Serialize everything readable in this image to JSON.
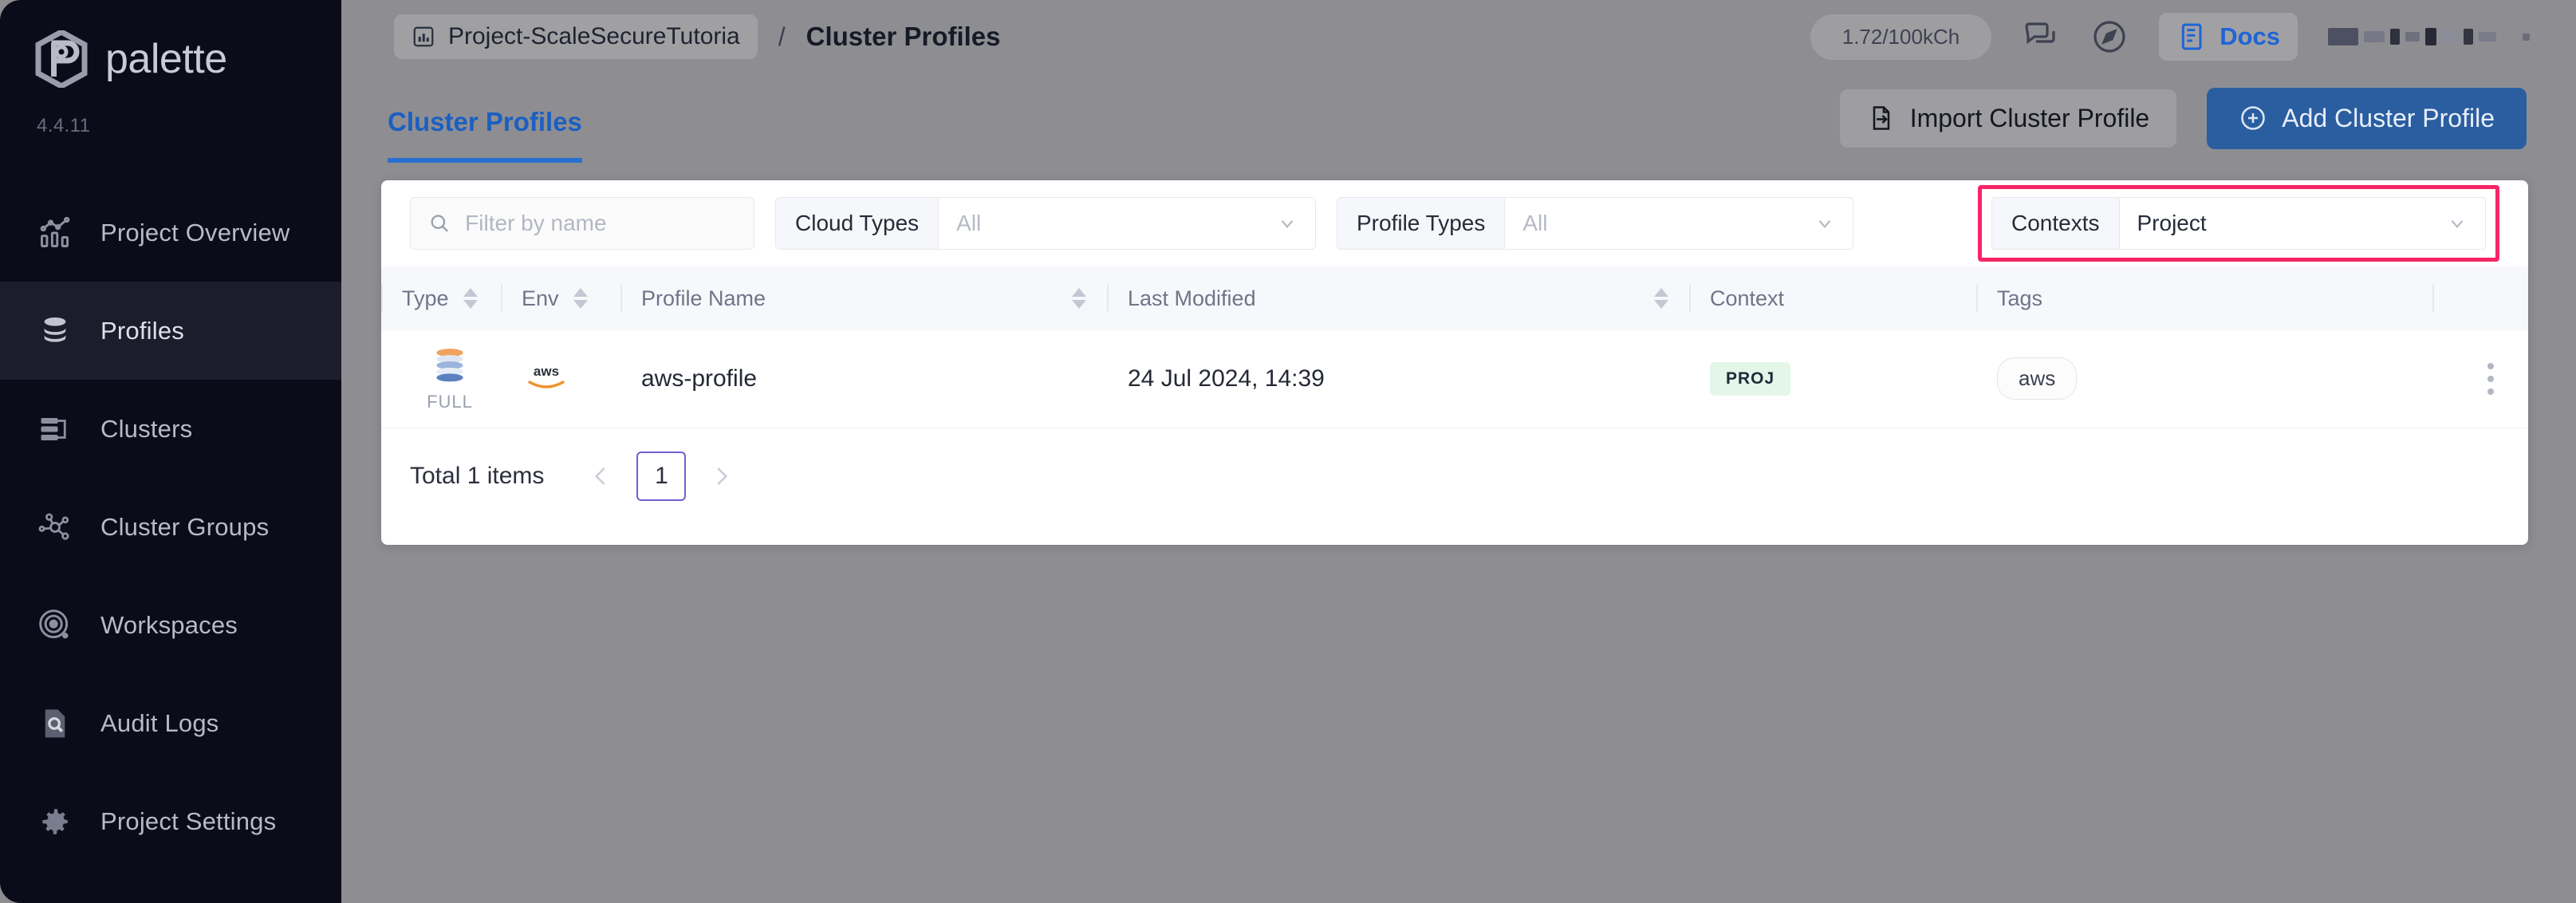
{
  "brand": {
    "name": "palette",
    "version": "4.4.11"
  },
  "sidebar": {
    "items": [
      {
        "label": "Project Overview",
        "icon": "chart-bars-icon",
        "active": false
      },
      {
        "label": "Profiles",
        "icon": "layers-stack-icon",
        "active": true
      },
      {
        "label": "Clusters",
        "icon": "server-rack-icon",
        "active": false
      },
      {
        "label": "Cluster Groups",
        "icon": "nodes-graph-icon",
        "active": false
      },
      {
        "label": "Workspaces",
        "icon": "orbit-icon",
        "active": false
      },
      {
        "label": "Audit Logs",
        "icon": "document-search-icon",
        "active": false
      },
      {
        "label": "Project Settings",
        "icon": "gear-icon",
        "active": false
      }
    ]
  },
  "topbar": {
    "breadcrumb_project": "Project-ScaleSecureTutoria",
    "breadcrumb_separator": "/",
    "breadcrumb_current": "Cluster Profiles",
    "usage": "1.72/100kCh",
    "docs_label": "Docs"
  },
  "pageheader": {
    "tabs": [
      {
        "label": "Cluster Profiles",
        "active": true
      }
    ],
    "import_label": "Import Cluster Profile",
    "add_label": "Add Cluster Profile"
  },
  "filters": {
    "search_placeholder": "Filter by name",
    "search_value": "",
    "cloud_types_label": "Cloud Types",
    "cloud_types_value": "All",
    "profile_types_label": "Profile Types",
    "profile_types_value": "All",
    "contexts_label": "Contexts",
    "contexts_value": "Project",
    "highlight_color": "#f72566"
  },
  "table": {
    "columns": [
      "Type",
      "Env",
      "Profile Name",
      "Last Modified",
      "Context",
      "Tags"
    ],
    "rows": [
      {
        "type_label": "FULL",
        "env": "aws",
        "profile_name": "aws-profile",
        "last_modified": "24 Jul 2024, 14:39",
        "context": "PROJ",
        "tags": [
          "aws"
        ]
      }
    ]
  },
  "footer": {
    "total": "Total 1 items",
    "page": "1"
  }
}
